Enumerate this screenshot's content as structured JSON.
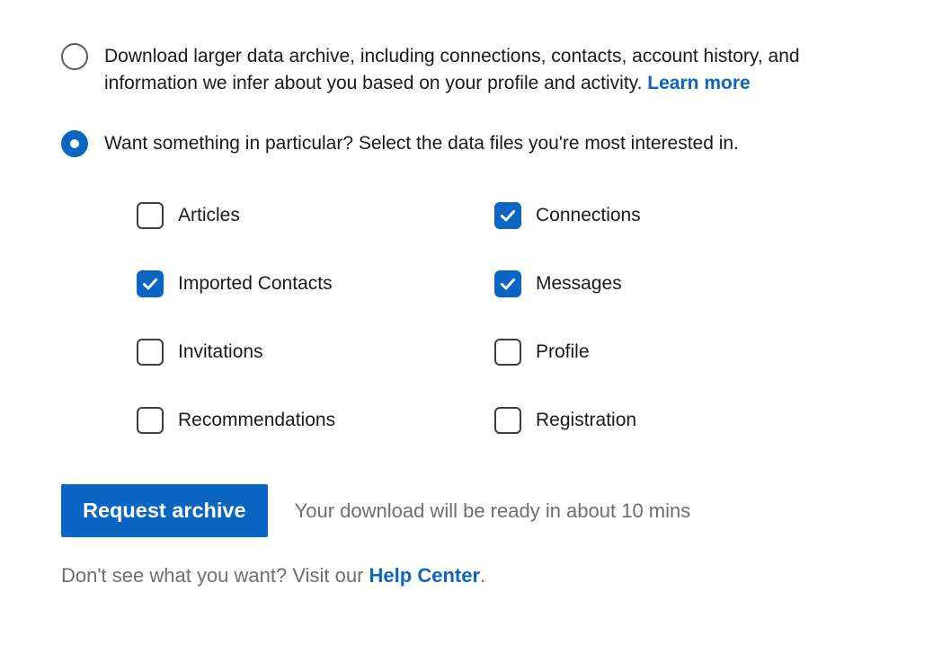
{
  "colors": {
    "accent": "#0a66c2",
    "text": "#1a1a1a",
    "muted": "#6e6e6e"
  },
  "radio_options": {
    "full_archive": {
      "text": "Download larger data archive, including connections, contacts, account history, and information we infer about you based on your profile and activity. ",
      "learn_more": "Learn more",
      "selected": false
    },
    "particular": {
      "text": "Want something in particular? Select the data files you're most interested in.",
      "selected": true
    }
  },
  "checkboxes": [
    {
      "label": "Articles",
      "checked": false
    },
    {
      "label": "Connections",
      "checked": true
    },
    {
      "label": "Imported Contacts",
      "checked": true
    },
    {
      "label": "Messages",
      "checked": true
    },
    {
      "label": "Invitations",
      "checked": false
    },
    {
      "label": "Profile",
      "checked": false
    },
    {
      "label": "Recommendations",
      "checked": false
    },
    {
      "label": "Registration",
      "checked": false
    }
  ],
  "action": {
    "button_label": "Request archive",
    "ready_text": "Your download will be ready in about 10 mins"
  },
  "help": {
    "prefix": "Don't see what you want? Visit our ",
    "link": "Help Center",
    "suffix": "."
  }
}
